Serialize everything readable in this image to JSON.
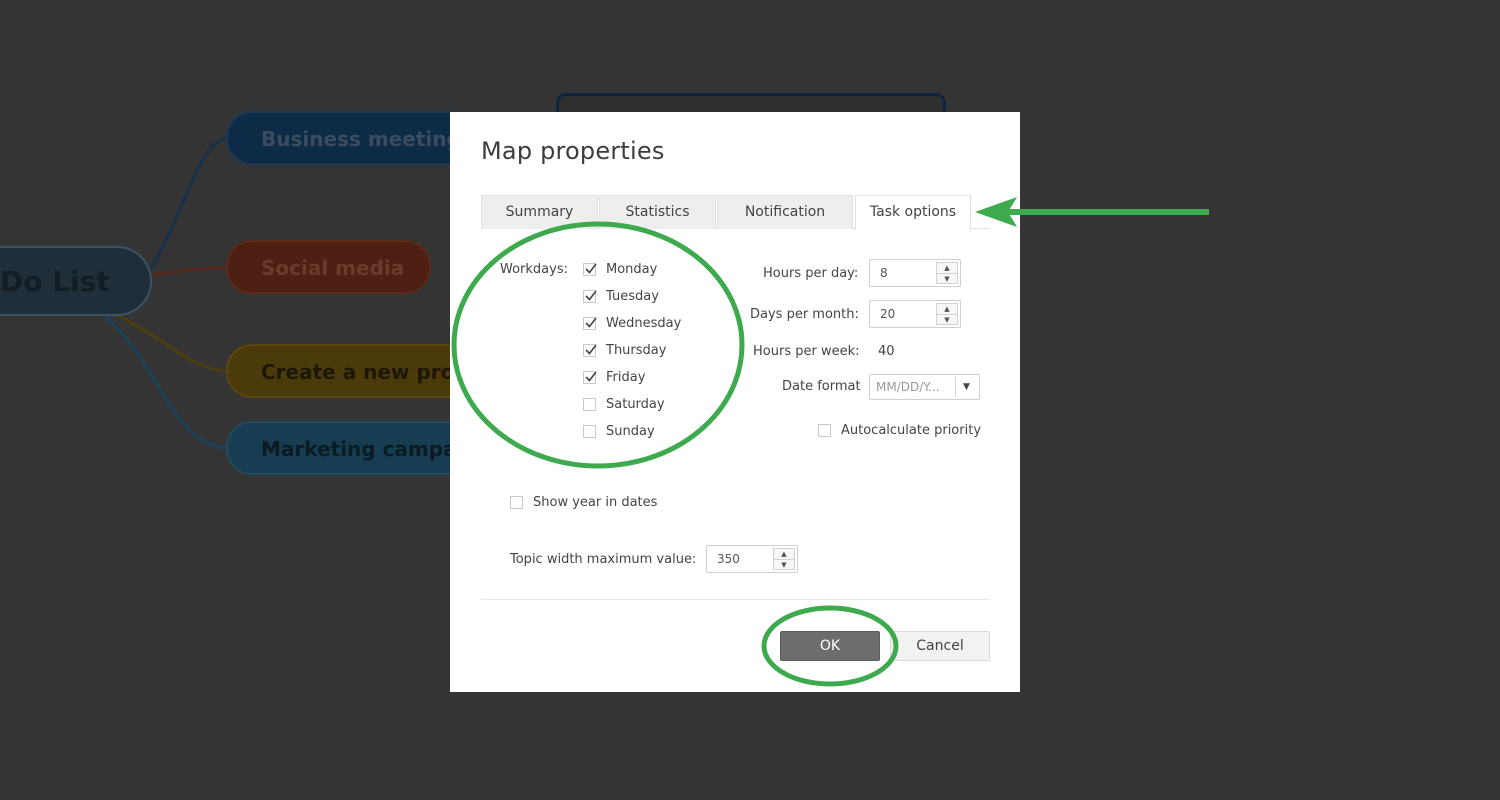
{
  "mind_map": {
    "root": "Do List",
    "topics": [
      "Business meeting",
      "Social media",
      "Create a new pro",
      "Marketing campai"
    ]
  },
  "dialog": {
    "title": "Map properties",
    "tabs": [
      {
        "label": "Summary",
        "active": false
      },
      {
        "label": "Statistics",
        "active": false
      },
      {
        "label": "Notification",
        "active": false
      },
      {
        "label": "Task options",
        "active": true
      }
    ],
    "workdays": {
      "label": "Workdays:",
      "days": [
        {
          "label": "Monday",
          "checked": true
        },
        {
          "label": "Tuesday",
          "checked": true
        },
        {
          "label": "Wednesday",
          "checked": true
        },
        {
          "label": "Thursday",
          "checked": true
        },
        {
          "label": "Friday",
          "checked": true
        },
        {
          "label": "Saturday",
          "checked": false
        },
        {
          "label": "Sunday",
          "checked": false
        }
      ]
    },
    "hours_per_day": {
      "label": "Hours per day:",
      "value": "8"
    },
    "days_per_month": {
      "label": "Days per month:",
      "value": "20"
    },
    "hours_per_week": {
      "label": "Hours per week:",
      "value": "40"
    },
    "date_format": {
      "label": "Date format",
      "value": "MM/DD/Y..."
    },
    "autocalculate_priority": {
      "label": "Autocalculate priority",
      "checked": false
    },
    "show_year_in_dates": {
      "label": "Show year in dates",
      "checked": false
    },
    "topic_width_max": {
      "label": "Topic width maximum value:",
      "value": "350"
    },
    "ok_label": "OK",
    "cancel_label": "Cancel"
  },
  "colors": {
    "annotation": "#3daa4e",
    "ok_button": "#6d6d6d",
    "overlay": "#343434"
  },
  "icons": {
    "spin_up": "▲",
    "spin_down": "▼",
    "dropdown": "▼"
  }
}
